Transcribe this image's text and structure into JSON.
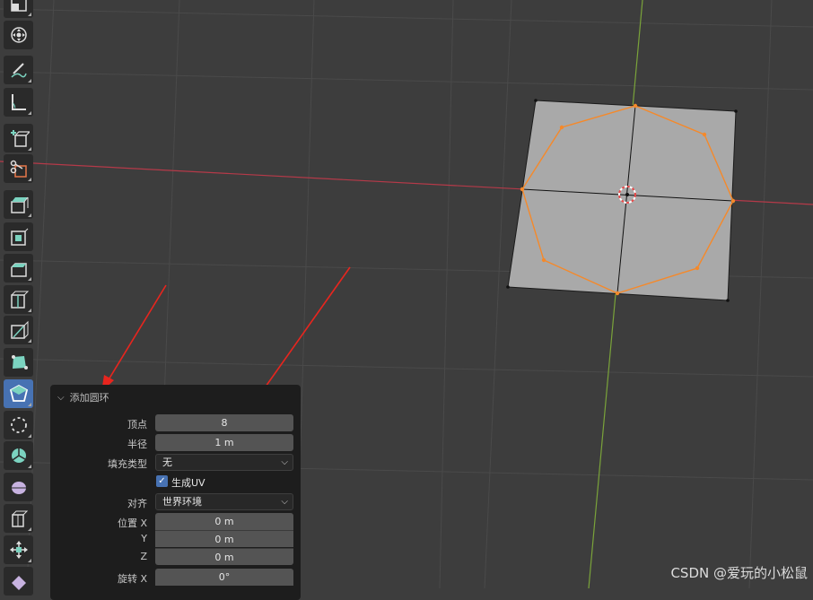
{
  "panel": {
    "title": "添加圆环",
    "vertices_label": "顶点",
    "vertices_value": "8",
    "radius_label": "半径",
    "radius_value": "1 m",
    "fill_type_label": "填充类型",
    "fill_type_value": "无",
    "generate_uv_label": "生成UV",
    "generate_uv_checked": true,
    "align_label": "对齐",
    "align_value": "世界环境",
    "location_x_label": "位置 X",
    "location_x_value": "0 m",
    "location_y_label": "Y",
    "location_y_value": "0 m",
    "location_z_label": "Z",
    "location_z_value": "0 m",
    "rotation_x_label": "旋转 X",
    "rotation_x_value": "0°"
  },
  "watermark": "CSDN @爱玩的小松鼠",
  "colors": {
    "viewport_bg": "#3d3d3d",
    "grid_line": "#4d4d4d",
    "x_axis": "#b53a49",
    "y_axis": "#7aa33a",
    "plane_fill": "#a9a9a9",
    "selection": "#f5892a",
    "active_tool": "#4772b3",
    "arrow": "#e8251e"
  },
  "tools": [
    {
      "name": "scale-cage-icon"
    },
    {
      "name": "transform-icon"
    },
    {
      "name": "annotate-icon"
    },
    {
      "name": "measure-icon"
    },
    {
      "name": "add-cube-icon"
    },
    {
      "name": "cut-cube-icon"
    },
    {
      "name": "extrude-region-icon"
    },
    {
      "name": "inset-faces-icon"
    },
    {
      "name": "bevel-icon"
    },
    {
      "name": "loop-cut-icon"
    },
    {
      "name": "knife-icon"
    },
    {
      "name": "poly-build-icon"
    },
    {
      "name": "spin-icon"
    },
    {
      "name": "smooth-vertices-icon"
    },
    {
      "name": "edge-slide-icon"
    },
    {
      "name": "shrink-fatten-icon"
    },
    {
      "name": "shear-icon"
    },
    {
      "name": "rip-region-icon"
    },
    {
      "name": "move-icon"
    },
    {
      "name": "eraser-icon"
    }
  ]
}
